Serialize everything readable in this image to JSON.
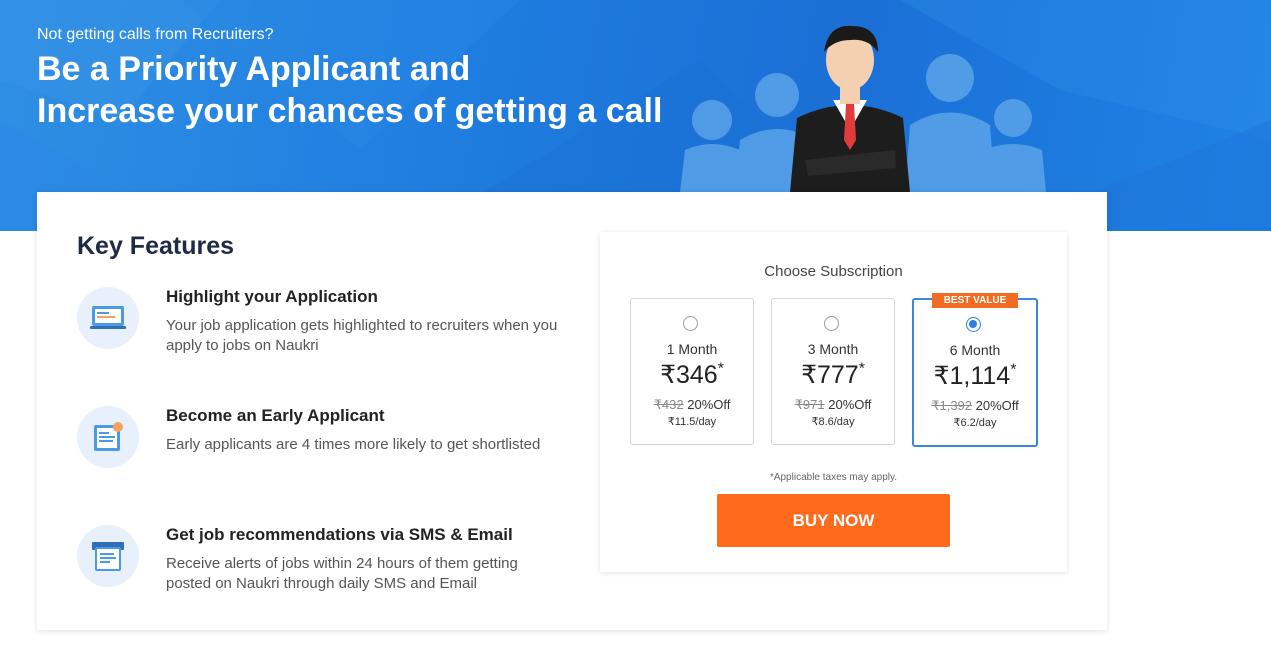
{
  "hero": {
    "kicker": "Not getting calls from Recruiters?",
    "headline_line1": "Be a Priority Applicant and",
    "headline_line2": "Increase your chances of getting a call"
  },
  "features": {
    "title": "Key Features",
    "items": [
      {
        "icon": "highlight-application-icon",
        "title": "Highlight your Application",
        "desc": "Your job application gets highlighted to recruiters when you apply to jobs on Naukri"
      },
      {
        "icon": "early-applicant-icon",
        "title": "Become an Early Applicant",
        "desc": "Early applicants are 4 times more likely to get shortlisted"
      },
      {
        "icon": "sms-email-icon",
        "title": "Get job recommendations via SMS & Email",
        "desc": "Receive alerts of jobs within 24 hours of them getting posted on Naukri through daily SMS and Email"
      }
    ]
  },
  "subscription": {
    "title": "Choose Subscription",
    "plans": [
      {
        "duration": "1 Month",
        "price": "₹346",
        "star": "*",
        "old_price": "₹432",
        "discount": "20%Off",
        "per_day": "₹11.5/day",
        "selected": false
      },
      {
        "duration": "3 Month",
        "price": "₹777",
        "star": "*",
        "old_price": "₹971",
        "discount": "20%Off",
        "per_day": "₹8.6/day",
        "selected": false
      },
      {
        "duration": "6 Month",
        "price": "₹1,114",
        "star": "*",
        "old_price": "₹1,392",
        "discount": "20%Off",
        "per_day": "₹6.2/day",
        "selected": true,
        "badge": "BEST VALUE"
      }
    ],
    "tax_note": "*Applicable taxes may apply.",
    "buy_label": "BUY NOW"
  },
  "colors": {
    "hero_blue": "#1f7ee0",
    "accent_orange": "#ff6a1c",
    "selected_blue": "#2d7fe6"
  }
}
